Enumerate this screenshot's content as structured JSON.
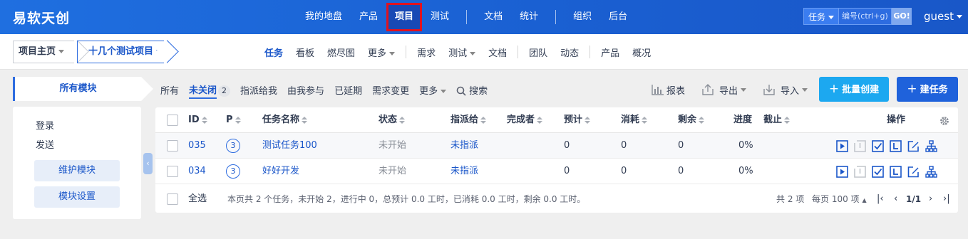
{
  "app": {
    "brand": "易软天创"
  },
  "main_nav": {
    "items": [
      {
        "label": "我的地盘"
      },
      {
        "label": "产品"
      },
      {
        "label": "项目",
        "active": true
      },
      {
        "label": "测试"
      },
      {
        "label": "文档"
      },
      {
        "label": "统计"
      },
      {
        "label": "组织"
      },
      {
        "label": "后台"
      }
    ]
  },
  "search": {
    "type_label": "任务",
    "placeholder": "编号(ctrl+g)",
    "go_label": "GO!"
  },
  "user": {
    "name": "guest"
  },
  "breadcrumb": {
    "home": "项目主页",
    "project": "十几个测试项目"
  },
  "sub_nav": {
    "items": [
      {
        "label": "任务",
        "active": true
      },
      {
        "label": "看板"
      },
      {
        "label": "燃尽图"
      },
      {
        "label": "更多"
      },
      {
        "label": "需求"
      },
      {
        "label": "测试"
      },
      {
        "label": "文档"
      },
      {
        "label": "团队"
      },
      {
        "label": "动态"
      },
      {
        "label": "产品"
      },
      {
        "label": "概况"
      }
    ]
  },
  "sidebar": {
    "module_tab": "所有模块",
    "modules": [
      "登录",
      "发送"
    ],
    "maintain_button": "维护模块",
    "settings_button": "模块设置"
  },
  "filters": {
    "items": [
      {
        "label": "所有"
      },
      {
        "label": "未关闭",
        "active": true,
        "count": "2"
      },
      {
        "label": "指派给我"
      },
      {
        "label": "由我参与"
      },
      {
        "label": "已延期"
      },
      {
        "label": "需求变更"
      },
      {
        "label": "更多"
      }
    ],
    "search_label": "搜索"
  },
  "toolbar": {
    "report_label": "报表",
    "export_label": "导出",
    "import_label": "导入",
    "batch_create_label": "批量创建",
    "create_label": "建任务"
  },
  "colors": {
    "primary": "#2d6ce0",
    "brand_bar": "#1a5fd1",
    "cyan_button": "#1ca8f0",
    "highlight": "#e0121f"
  },
  "table": {
    "headers": {
      "id": "ID",
      "pri": "P",
      "name": "任务名称",
      "status": "状态",
      "assigned": "指派给",
      "finished_by": "完成者",
      "estimate": "预计",
      "consumed": "消耗",
      "left": "剩余",
      "progress": "进度",
      "deadline": "截止",
      "actions": "操作"
    },
    "rows": [
      {
        "id": "035",
        "pri": "3",
        "name": "测试任务100",
        "status": "未开始",
        "assigned": "未指派",
        "finished_by": "",
        "estimate": "0",
        "consumed": "0",
        "left": "0",
        "progress": "0%",
        "deadline": ""
      },
      {
        "id": "034",
        "pri": "3",
        "name": "好好开发",
        "status": "未开始",
        "assigned": "未指派",
        "finished_by": "",
        "estimate": "0",
        "consumed": "0",
        "left": "0",
        "progress": "0%",
        "deadline": ""
      }
    ],
    "action_icons": [
      "start-icon",
      "finish-icon",
      "close-task-icon",
      "record-estimate-icon",
      "edit-icon",
      "subtask-icon"
    ]
  },
  "footer": {
    "select_all": "全选",
    "summary": "本页共 2 个任务，未开始 2，进行中 0，总预计 0.0 工时，已消耗 0.0 工时，剩余 0.0 工时。",
    "total": "共 2 项",
    "per_page": "每页 100 项",
    "page": "1/1"
  }
}
